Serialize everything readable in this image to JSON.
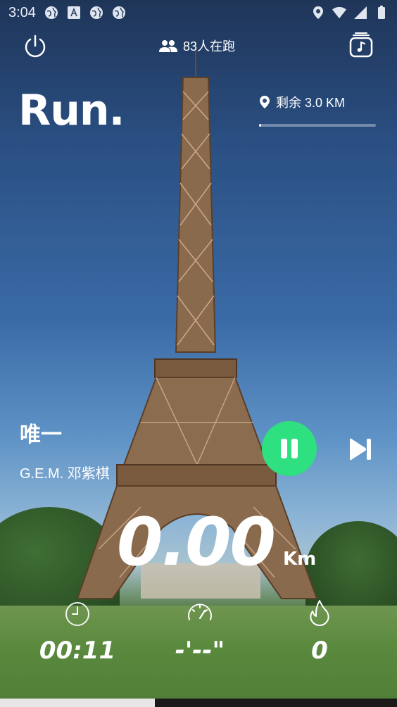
{
  "status_bar": {
    "time": "3:04"
  },
  "header": {
    "runners_count": "83人在跑"
  },
  "logo": "Run.",
  "remaining": {
    "label": "剩余 3.0 KM",
    "progress_fraction": 0.02
  },
  "song": {
    "title": "唯一",
    "artist": "G.E.M. 邓紫棋"
  },
  "distance": {
    "value": "0.00",
    "unit": "Km"
  },
  "stats": {
    "time": "00:11",
    "pace": "-'--\"",
    "calories": "0"
  },
  "colors": {
    "accent": "#2ee07f"
  },
  "icons": {
    "power": "power-icon",
    "runners": "people-icon",
    "music": "music-icon",
    "location": "location-pin-icon",
    "pause": "pause-icon",
    "next": "skip-next-icon",
    "clock": "clock-icon",
    "speedometer": "speedometer-icon",
    "flame": "flame-icon"
  }
}
